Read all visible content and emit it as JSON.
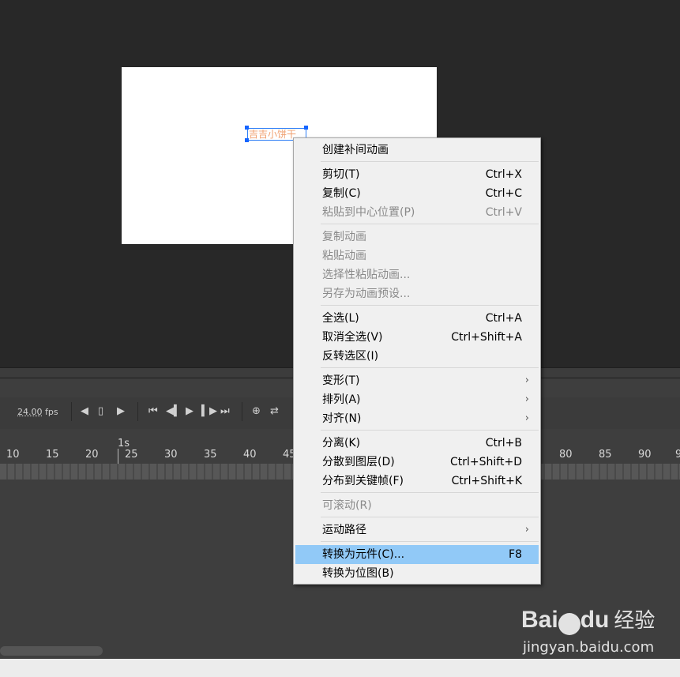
{
  "stage": {
    "text_object": "吉吉小饼干"
  },
  "timeline": {
    "fps_value": "24.00",
    "fps_unit": "fps",
    "second_marker": "1s",
    "frame_numbers": [
      "10",
      "15",
      "20",
      "25",
      "30",
      "35",
      "40",
      "45",
      "80",
      "85",
      "90",
      "9"
    ]
  },
  "context_menu": {
    "items": [
      {
        "label": "创建补间动画",
        "shortcut": "",
        "submenu": false,
        "disabled": false
      },
      {
        "label": "剪切(T)",
        "shortcut": "Ctrl+X",
        "submenu": false,
        "disabled": false
      },
      {
        "label": "复制(C)",
        "shortcut": "Ctrl+C",
        "submenu": false,
        "disabled": false
      },
      {
        "label": "粘贴到中心位置(P)",
        "shortcut": "Ctrl+V",
        "submenu": false,
        "disabled": true
      },
      {
        "label": "复制动画",
        "shortcut": "",
        "submenu": false,
        "disabled": true
      },
      {
        "label": "粘贴动画",
        "shortcut": "",
        "submenu": false,
        "disabled": true
      },
      {
        "label": "选择性粘贴动画...",
        "shortcut": "",
        "submenu": false,
        "disabled": true
      },
      {
        "label": "另存为动画预设...",
        "shortcut": "",
        "submenu": false,
        "disabled": true
      },
      {
        "label": "全选(L)",
        "shortcut": "Ctrl+A",
        "submenu": false,
        "disabled": false
      },
      {
        "label": "取消全选(V)",
        "shortcut": "Ctrl+Shift+A",
        "submenu": false,
        "disabled": false
      },
      {
        "label": "反转选区(I)",
        "shortcut": "",
        "submenu": false,
        "disabled": false
      },
      {
        "label": "变形(T)",
        "shortcut": "",
        "submenu": true,
        "disabled": false
      },
      {
        "label": "排列(A)",
        "shortcut": "",
        "submenu": true,
        "disabled": false
      },
      {
        "label": "对齐(N)",
        "shortcut": "",
        "submenu": true,
        "disabled": false
      },
      {
        "label": "分离(K)",
        "shortcut": "Ctrl+B",
        "submenu": false,
        "disabled": false
      },
      {
        "label": "分散到图层(D)",
        "shortcut": "Ctrl+Shift+D",
        "submenu": false,
        "disabled": false
      },
      {
        "label": "分布到关键帧(F)",
        "shortcut": "Ctrl+Shift+K",
        "submenu": false,
        "disabled": false
      },
      {
        "label": "可滚动(R)",
        "shortcut": "",
        "submenu": false,
        "disabled": true
      },
      {
        "label": "运动路径",
        "shortcut": "",
        "submenu": true,
        "disabled": false
      },
      {
        "label": "转换为元件(C)...",
        "shortcut": "F8",
        "submenu": false,
        "disabled": false,
        "highlighted": true
      },
      {
        "label": "转换为位图(B)",
        "shortcut": "",
        "submenu": false,
        "disabled": false
      }
    ]
  },
  "watermark": {
    "logo": "Bai",
    "logo_tail": "du",
    "suffix": "经验",
    "url": "jingyan.baidu.com"
  },
  "colors": {
    "highlight": "#91c9f7",
    "selection_border": "#2f7ff6",
    "text_object_color": "#f0a070"
  }
}
